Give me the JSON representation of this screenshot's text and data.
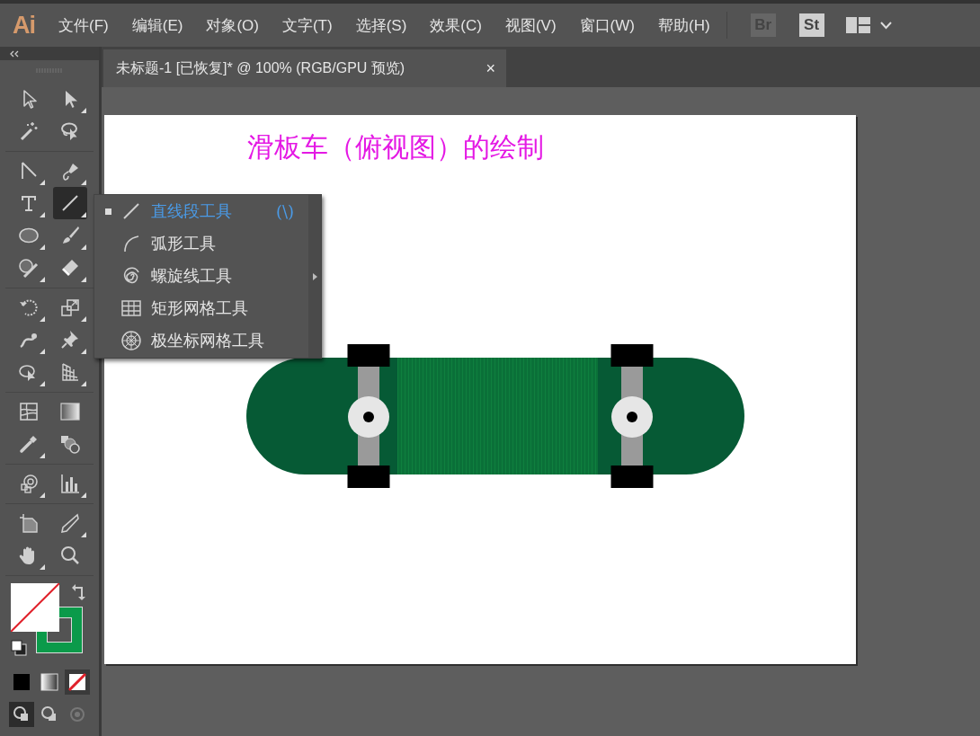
{
  "app": {
    "logo": "Ai"
  },
  "menu": [
    "文件(F)",
    "编辑(E)",
    "对象(O)",
    "文字(T)",
    "选择(S)",
    "效果(C)",
    "视图(V)",
    "窗口(W)",
    "帮助(H)"
  ],
  "bridge_buttons": [
    {
      "label": "Br",
      "disabled": true
    },
    {
      "label": "St",
      "disabled": false
    }
  ],
  "document_tab": {
    "title": "未标题-1 [已恢复]* @ 100% (RGB/GPU 预览)",
    "close": "×"
  },
  "toolbar": {
    "groups": [
      [
        {
          "kind": "selection",
          "selected": false,
          "flyout": false
        },
        {
          "kind": "direct-selection",
          "selected": false,
          "flyout": true
        },
        {
          "kind": "magic-wand",
          "selected": false,
          "flyout": false
        },
        {
          "kind": "lasso",
          "selected": false,
          "flyout": false
        }
      ],
      [
        {
          "kind": "curvature",
          "selected": false,
          "flyout": true
        },
        {
          "kind": "pen",
          "selected": false,
          "flyout": true
        },
        {
          "kind": "type",
          "selected": false,
          "flyout": true
        },
        {
          "kind": "line",
          "selected": true,
          "flyout": true
        },
        {
          "kind": "ellipse",
          "selected": false,
          "flyout": true
        },
        {
          "kind": "brush",
          "selected": false,
          "flyout": true
        },
        {
          "kind": "shaper",
          "selected": false,
          "flyout": true
        },
        {
          "kind": "eraser",
          "selected": false,
          "flyout": true
        }
      ],
      [
        {
          "kind": "rotate",
          "selected": false,
          "flyout": true
        },
        {
          "kind": "scale",
          "selected": false,
          "flyout": true
        },
        {
          "kind": "warp",
          "selected": false,
          "flyout": true
        },
        {
          "kind": "pin",
          "selected": false,
          "flyout": true
        },
        {
          "kind": "free-transform",
          "selected": false,
          "flyout": true
        },
        {
          "kind": "perspective",
          "selected": false,
          "flyout": true
        }
      ],
      [
        {
          "kind": "mesh",
          "selected": false,
          "flyout": false
        },
        {
          "kind": "gradient",
          "selected": false,
          "flyout": false
        },
        {
          "kind": "eyedropper",
          "selected": false,
          "flyout": true
        },
        {
          "kind": "blend",
          "selected": false,
          "flyout": false
        }
      ],
      [
        {
          "kind": "symbol",
          "selected": false,
          "flyout": true
        },
        {
          "kind": "graph",
          "selected": false,
          "flyout": true
        }
      ],
      [
        {
          "kind": "artboard",
          "selected": false,
          "flyout": false
        },
        {
          "kind": "knife",
          "selected": false,
          "flyout": true
        },
        {
          "kind": "hand",
          "selected": false,
          "flyout": true
        },
        {
          "kind": "zoom",
          "selected": false,
          "flyout": false
        }
      ]
    ],
    "swatches": [
      {
        "kind": "fill",
        "none": true,
        "color": "#ffffff"
      },
      {
        "kind": "stroke",
        "none": false,
        "color": "#0b9a4a"
      }
    ],
    "color_modes": [
      {
        "kind": "color",
        "selected": false
      },
      {
        "kind": "gradient",
        "selected": false
      },
      {
        "kind": "none",
        "selected": true
      }
    ],
    "draw_modes": [
      {
        "kind": "normal",
        "selected": true
      },
      {
        "kind": "behind",
        "selected": false
      },
      {
        "kind": "inside",
        "selected": false,
        "disabled": true
      }
    ]
  },
  "flyout": {
    "items": [
      {
        "kind": "line",
        "label": "直线段工具",
        "shortcut": "(\\)",
        "selected": true
      },
      {
        "kind": "arc",
        "label": "弧形工具",
        "selected": false
      },
      {
        "kind": "spiral",
        "label": "螺旋线工具",
        "selected": false
      },
      {
        "kind": "rect-grid",
        "label": "矩形网格工具",
        "selected": false
      },
      {
        "kind": "polar-grid",
        "label": "极坐标网格工具",
        "selected": false
      }
    ]
  },
  "artboard": {
    "title": "滑板车（俯视图）的绘制"
  }
}
